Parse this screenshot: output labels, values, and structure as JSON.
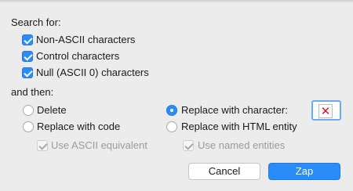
{
  "search_for": {
    "heading": "Search for:",
    "options": [
      {
        "label": "Non-ASCII characters",
        "checked": true
      },
      {
        "label": "Control characters",
        "checked": true
      },
      {
        "label": "Null (ASCII 0) characters",
        "checked": true
      }
    ]
  },
  "and_then": {
    "heading": "and then:",
    "actions": [
      {
        "label": "Delete",
        "selected": false
      },
      {
        "label": "Replace with character:",
        "selected": true
      },
      {
        "label": "Replace with code",
        "selected": false
      },
      {
        "label": "Replace with HTML entity",
        "selected": false
      }
    ],
    "sub_options": [
      {
        "label": "Use ASCII equivalent",
        "checked": true,
        "enabled": false
      },
      {
        "label": "Use named entities",
        "checked": true,
        "enabled": false
      }
    ],
    "replacement_char": {
      "glyph": "✕",
      "icon": "replacement-char-x-icon"
    }
  },
  "buttons": {
    "cancel": "Cancel",
    "zap": "Zap"
  },
  "colors": {
    "accent": "#2a8cf7",
    "window_bg": "#ececec",
    "replacement_glyph": "#d4162b"
  }
}
